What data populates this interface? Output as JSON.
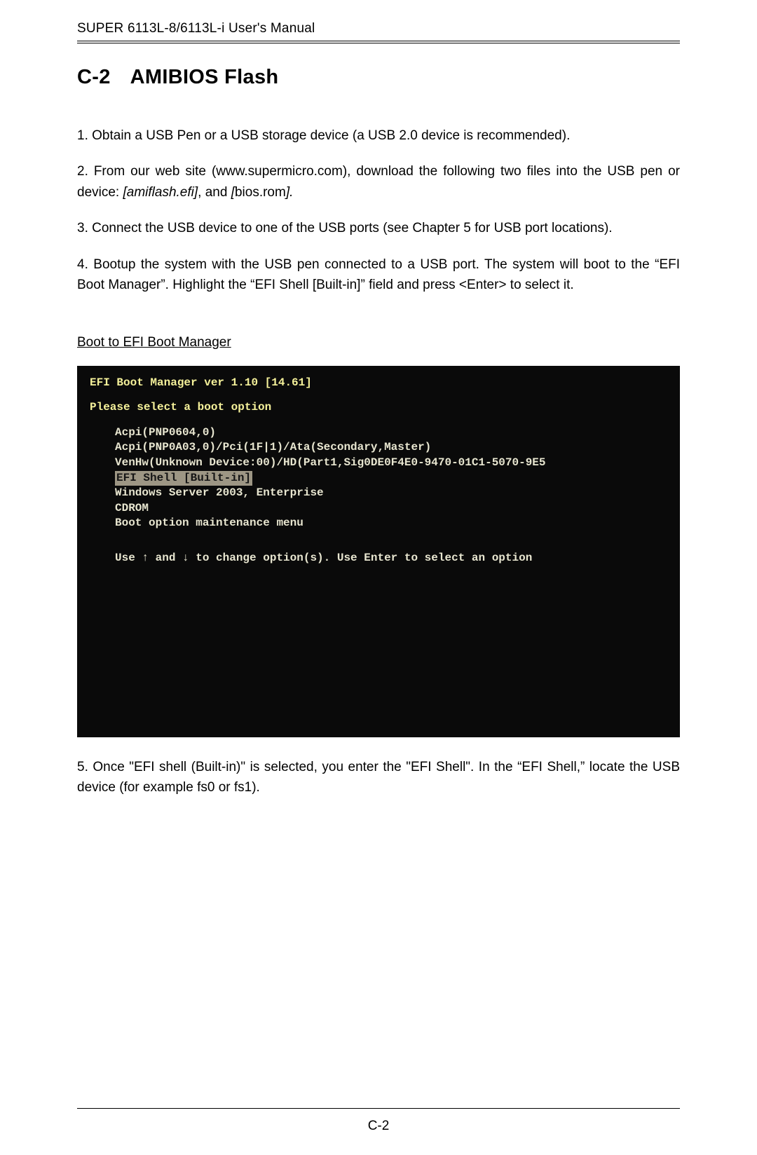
{
  "header": "SUPER 6113L-8/6113L-i User's Manual",
  "section": {
    "number": "C-2",
    "title": "AMIBIOS Flash"
  },
  "steps": {
    "s1": "1. Obtain a USB Pen or a USB storage device (a USB 2.0 device is recommended).",
    "s2a": "2. From our web site (www.supermicro.com), download the following two files into the USB pen or device: ",
    "s2_file1": "[amiflash.efi]",
    "s2_mid": ",   and ",
    "s2_file2": "[",
    "s2_file2b": "bios.rom",
    "s2_file2c": "].",
    "s3": "3. Connect the USB device to one of the USB ports (see Chapter 5 for USB port locations).",
    "s4": "4. Bootup the system with the USB pen connected to a USB port. The system will boot to the “EFI Boot Manager”.  Highlight the “EFI Shell [Built-in]” field and press <Enter> to select it.",
    "s5": "5. Once \"EFI shell (Built-in)\" is selected, you enter the \"EFI Shell\".  In the “EFI Shell,” locate the USB device (for example fs0 or fs1)."
  },
  "caption": "Boot to EFI Boot Manager",
  "terminal": {
    "title": "EFI Boot Manager ver 1.10 [14.61]",
    "prompt": "Please select a boot option",
    "items": [
      "Acpi(PNP0604,0)",
      "Acpi(PNP0A03,0)/Pci(1F|1)/Ata(Secondary,Master)",
      "VenHw(Unknown Device:00)/HD(Part1,Sig0DE0F4E0-9470-01C1-5070-9E5",
      "EFI Shell [Built-in]",
      "Windows Server 2003, Enterprise",
      "CDROM",
      "Boot option maintenance menu"
    ],
    "instruction": "Use ↑ and ↓ to change option(s). Use Enter to select an option"
  },
  "footer": "C-2"
}
